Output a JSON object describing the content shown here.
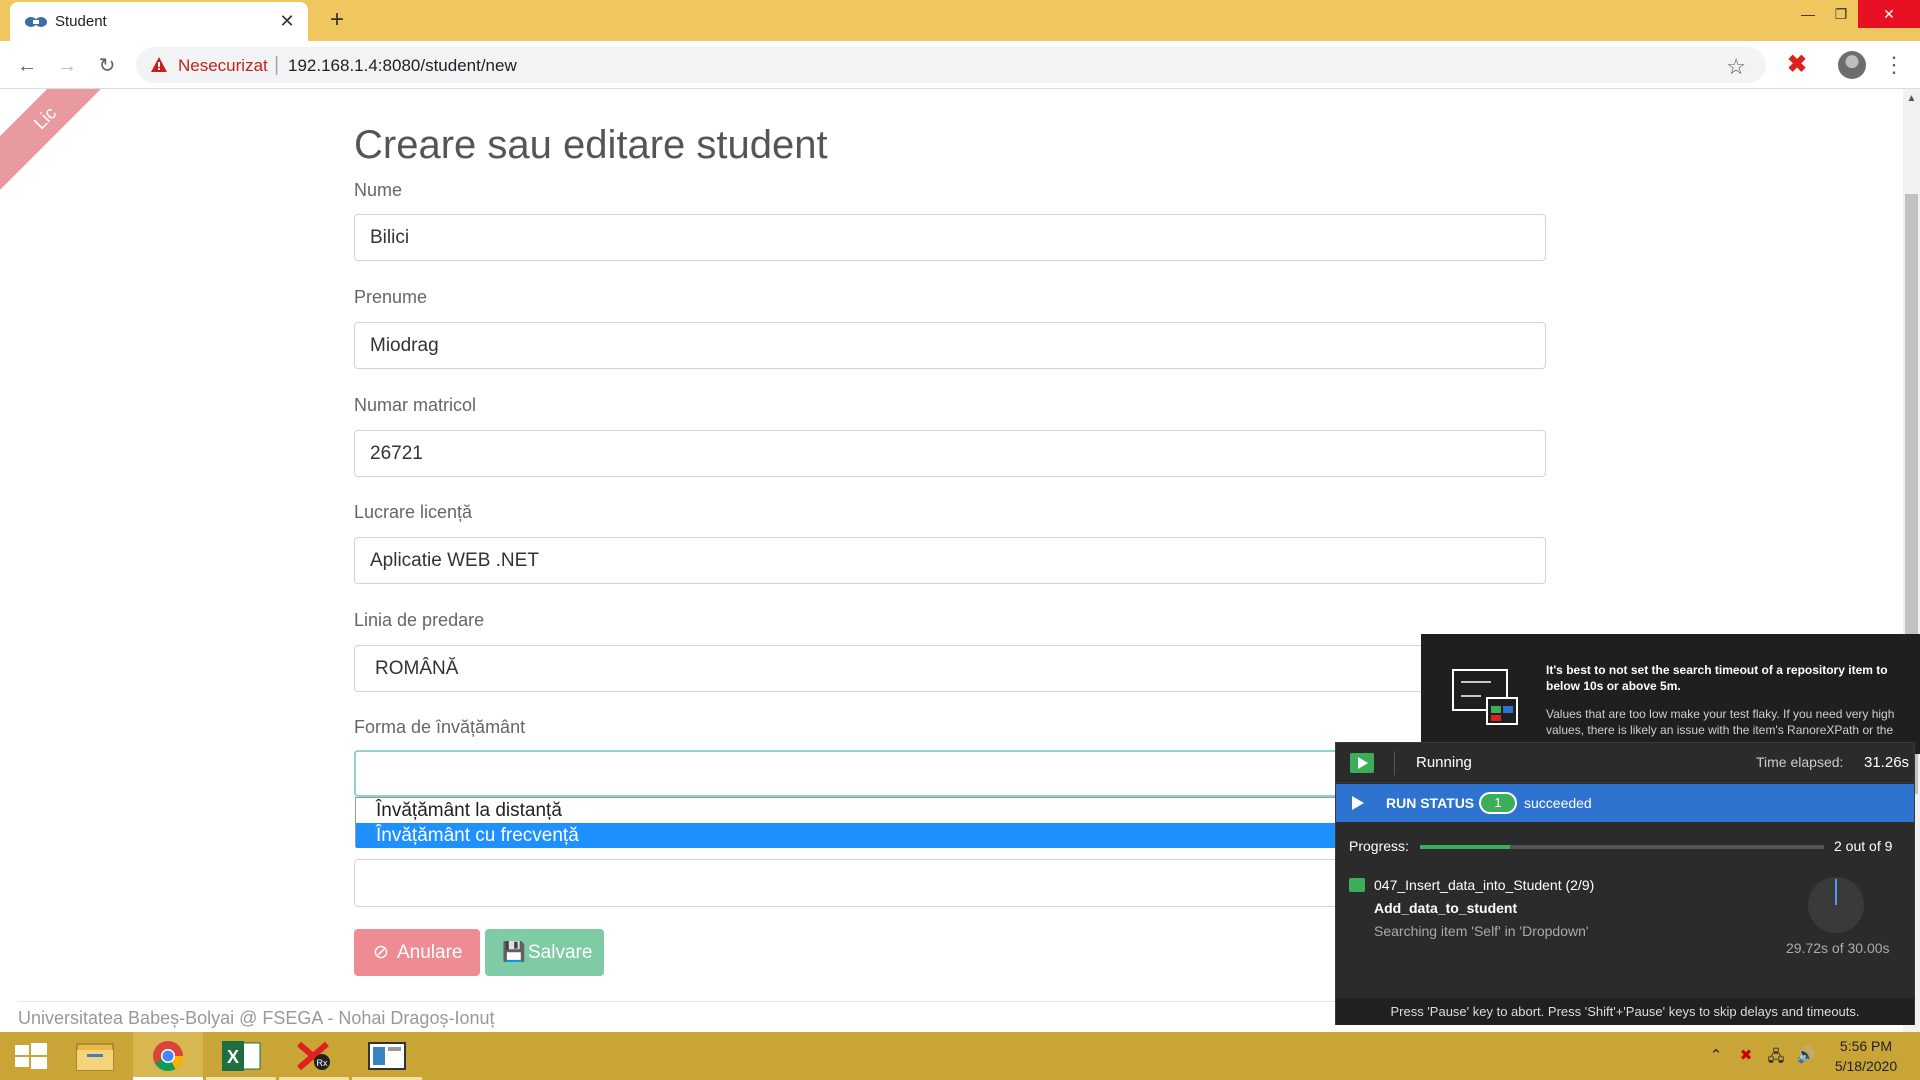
{
  "browser": {
    "tab_title": "Student",
    "not_secure": "Nesecurizat",
    "url_sep": "|",
    "url": "192.168.1.4:8080/student/new"
  },
  "ribbon_text": "Lic",
  "form": {
    "title": "Creare sau editare student",
    "nume_label": "Nume",
    "nume_value": "Bilici",
    "prenume_label": "Prenume",
    "prenume_value": "Miodrag",
    "matricol_label": "Numar matricol",
    "matricol_value": "26721",
    "lucrare_label": "Lucrare licență",
    "lucrare_value": "Aplicatie WEB .NET",
    "linia_label": "Linia de predare",
    "linia_value": "ROMÂNĂ",
    "forma_label": "Forma de învățământ",
    "forma_value": "",
    "forma_options": [
      "Învățământ la distanță",
      "Învățământ cu frecvență"
    ],
    "forma_highlighted": "Învățământ cu frecvență",
    "cancel_label": "Anulare",
    "save_label": "Salvare"
  },
  "footer": "Universitatea Babeș-Bolyai @ FSEGA - Nohai Dragoș-Ionuț",
  "tip": {
    "title": "It's best to not set the search timeout of a repository item to below 10s or above 5m.",
    "body": "Values that are too low make your test flaky. If you need very high values, there is likely an issue with the item's RanoreXPath or the"
  },
  "runner": {
    "state": "Running",
    "elapsed_label": "Time elapsed:",
    "elapsed_value": "31.26s",
    "status_label": "RUN STATUS",
    "succeeded_count": "1",
    "succeeded_label": "succeeded",
    "progress_label": "Progress:",
    "progress_text": "2 out of 9",
    "progress_fraction": 0.222,
    "test_case": "047_Insert_data_into_Student (2/9)",
    "module": "Add_data_to_student",
    "activity": "Searching item 'Self' in 'Dropdown'",
    "timer": "29.72s of 30.00s",
    "footer": "Press 'Pause' key to abort. Press 'Shift'+'Pause' keys to skip delays and timeouts."
  },
  "taskbar": {
    "time": "5:56 PM",
    "date": "5/18/2020"
  },
  "colors": {
    "tabstrip": "#f0c75e",
    "taskbar": "#c9a437",
    "cancel": "#ee8c93",
    "save": "#7ecba6",
    "highlight": "#1e90ff",
    "run_bar": "#2f73d0"
  }
}
